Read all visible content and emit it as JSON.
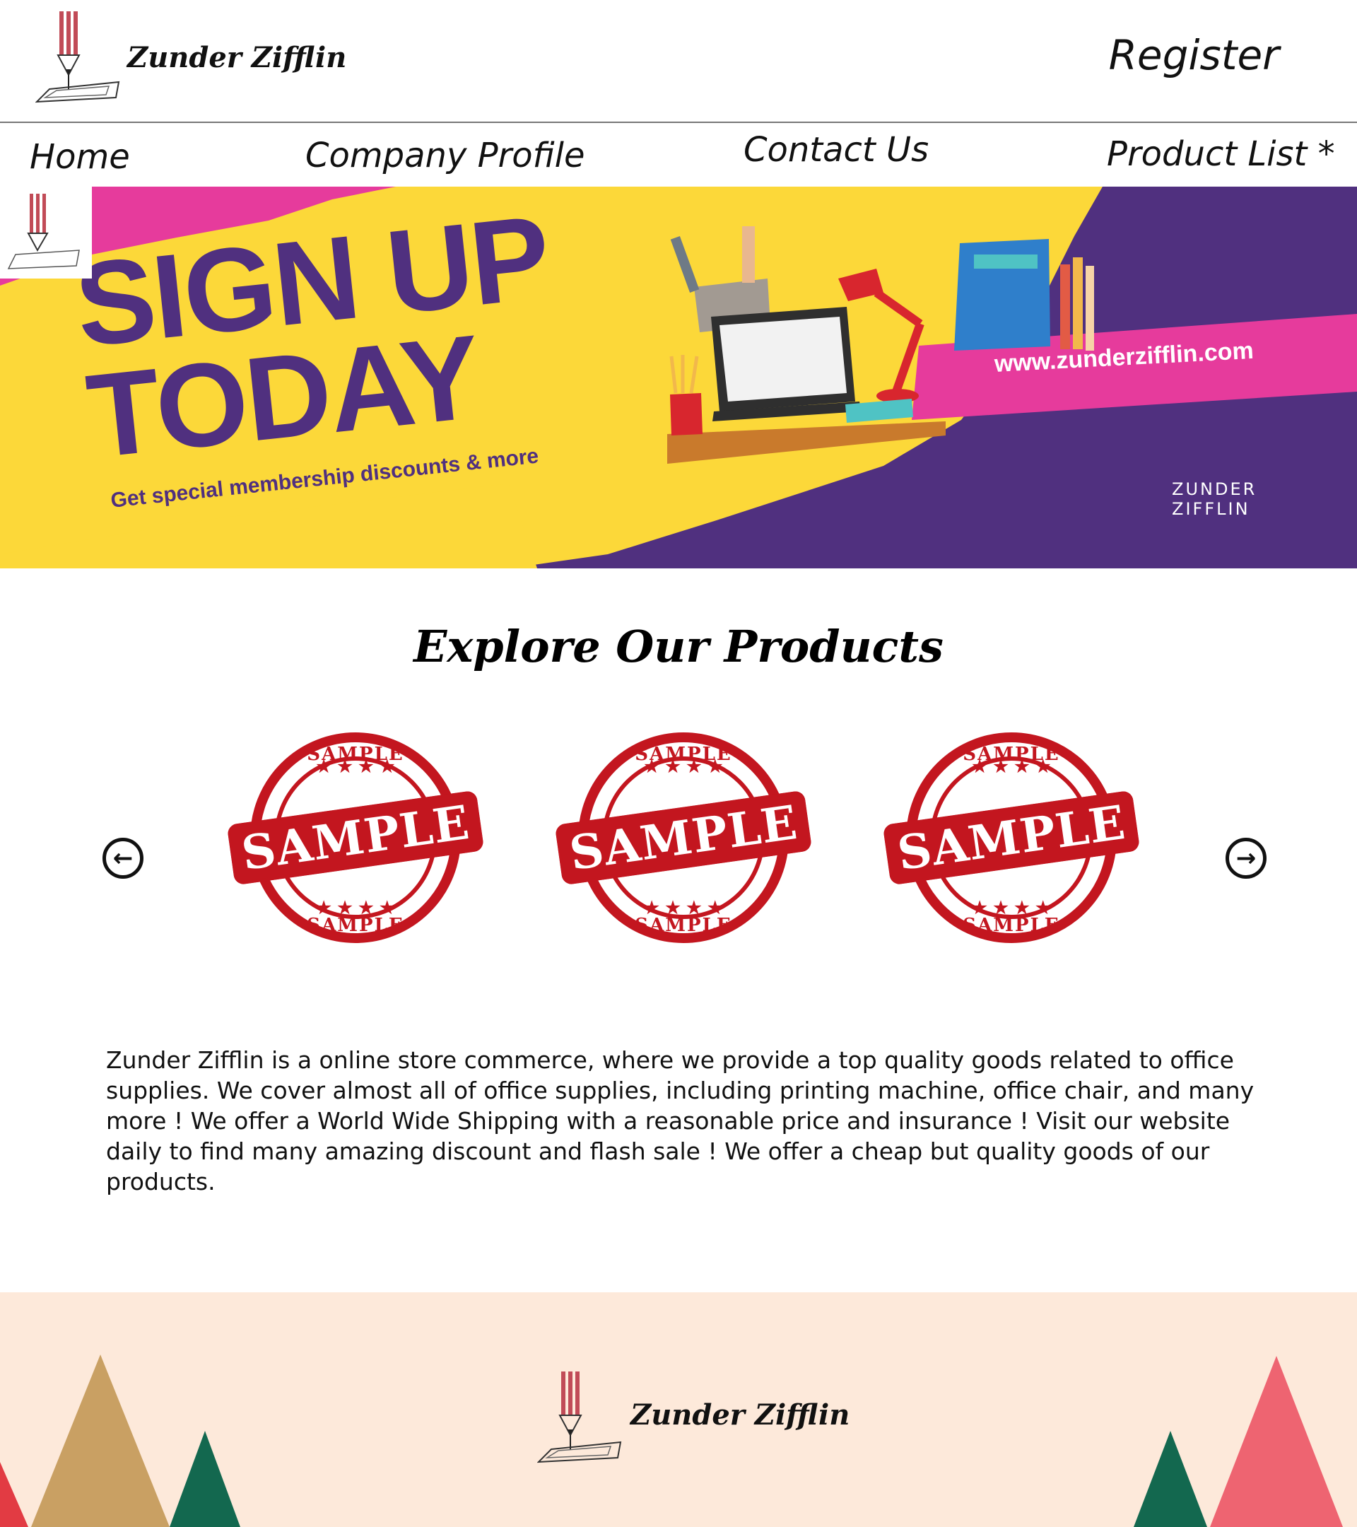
{
  "header": {
    "brand_name": "Zunder Zifflin",
    "register_label": "Register"
  },
  "nav": {
    "items": [
      {
        "label": "Home"
      },
      {
        "label": "Company Profile"
      },
      {
        "label": "Contact Us"
      },
      {
        "label": "Product List *"
      }
    ]
  },
  "banner": {
    "headline_line1": "SIGN UP",
    "headline_line2": "TODAY",
    "tagline": "Get special membership discounts & more",
    "url": "www.zunderzifflin.com",
    "logo_line1": "ZUNDER",
    "logo_line2": "ZIFFLIN",
    "colors": {
      "magenta": "#e63b9c",
      "yellow": "#fcd839",
      "purple": "#50307f"
    }
  },
  "products": {
    "title": "Explore Our Products",
    "prev_icon": "arrow-left-circle-icon",
    "next_icon": "arrow-right-circle-icon",
    "items": [
      {
        "stamp_text": "SAMPLE"
      },
      {
        "stamp_text": "SAMPLE"
      },
      {
        "stamp_text": "SAMPLE"
      }
    ]
  },
  "description": {
    "text": "Zunder Zifflin is a online store commerce, where we provide a top quality goods related to office supplies. We cover almost all of office supplies, including printing machine, office chair, and many more ! We offer a World Wide Shipping with a reasonable price and insurance ! Visit our website daily to find many amazing discount and flash sale ! We offer a cheap but quality goods of our products."
  },
  "footer": {
    "brand_name": "Zunder Zifflin",
    "background": "#fde9da"
  }
}
